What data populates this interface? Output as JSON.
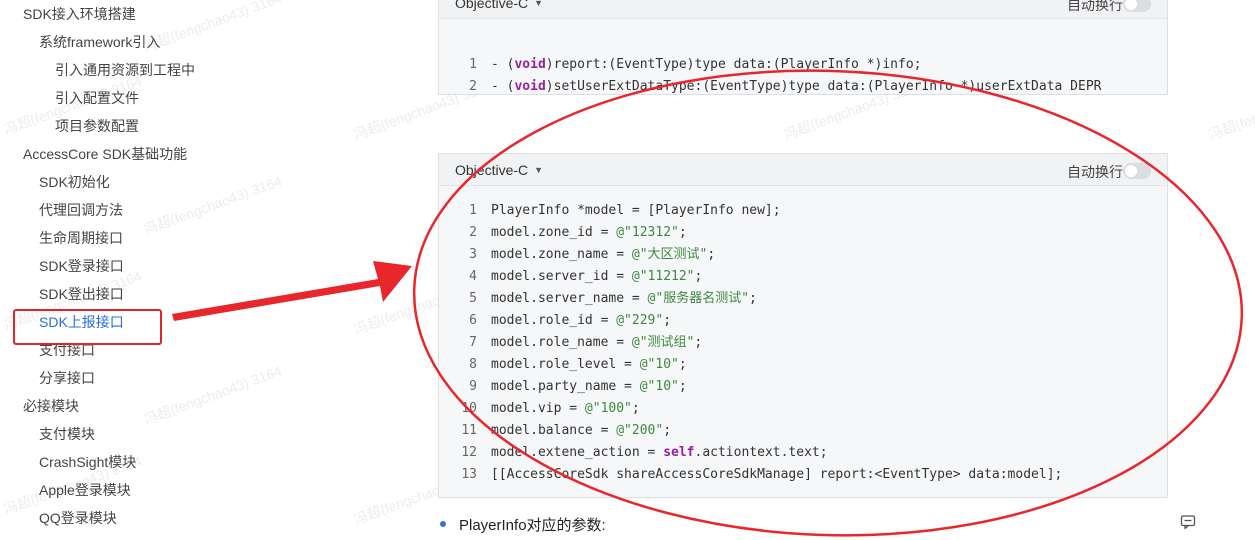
{
  "sidebar": {
    "items": [
      {
        "label": "SDK接入环境搭建"
      },
      {
        "label": "系统framework引入"
      },
      {
        "label": "引入通用资源到工程中"
      },
      {
        "label": "引入配置文件"
      },
      {
        "label": "项目参数配置"
      },
      {
        "label": "AccessCore SDK基础功能"
      },
      {
        "label": "SDK初始化"
      },
      {
        "label": "代理回调方法"
      },
      {
        "label": "生命周期接口"
      },
      {
        "label": "SDK登录接口"
      },
      {
        "label": "SDK登出接口"
      },
      {
        "label": "SDK上报接口"
      },
      {
        "label": "支付接口"
      },
      {
        "label": "分享接口"
      },
      {
        "label": "必接模块"
      },
      {
        "label": "支付模块"
      },
      {
        "label": "CrashSight模块"
      },
      {
        "label": "Apple登录模块"
      },
      {
        "label": "QQ登录模块"
      }
    ]
  },
  "code_blocks": [
    {
      "language": "Objective-C",
      "wrap_label": "自动换行",
      "wrap_enabled": false,
      "lines": [
        {
          "n": "1",
          "code": "- (void)report:(EventType)type data:(PlayerInfo *)info;"
        },
        {
          "n": "2",
          "code": "- (void)setUserExtDataType:(EventType)type data:(PlayerInfo *)userExtData DEPR"
        }
      ]
    },
    {
      "language": "Objective-C",
      "wrap_label": "自动换行",
      "wrap_enabled": false,
      "lines": [
        {
          "n": "1",
          "code": "PlayerInfo *model = [PlayerInfo new];"
        },
        {
          "n": "2",
          "code": "model.zone_id = @\"12312\";"
        },
        {
          "n": "3",
          "code": "model.zone_name = @\"大区测试\";"
        },
        {
          "n": "4",
          "code": "model.server_id = @\"11212\";"
        },
        {
          "n": "5",
          "code": "model.server_name = @\"服务器名测试\";"
        },
        {
          "n": "6",
          "code": "model.role_id = @\"229\";"
        },
        {
          "n": "7",
          "code": "model.role_name = @\"测试组\";"
        },
        {
          "n": "8",
          "code": "model.role_level = @\"10\";"
        },
        {
          "n": "9",
          "code": "model.party_name = @\"10\";"
        },
        {
          "n": "10",
          "code": "model.vip = @\"100\";"
        },
        {
          "n": "11",
          "code": "model.balance = @\"200\";"
        },
        {
          "n": "12",
          "code": "model.extene_action = self.actiontext.text;"
        },
        {
          "n": "13",
          "code": "[[AccessCoreSdk shareAccessCoreSdkManage] report:<EventType> data:model];"
        }
      ]
    }
  ],
  "bullet_text": "PlayerInfo对应的参数:",
  "watermark_text": "冯超(fengchao43) 3164",
  "colors": {
    "accent": "#2a6bdc",
    "annotation": "#e0242a",
    "keyword": "#9a1f9e",
    "string": "#3b8a3b"
  },
  "icons": {
    "comment": "comment-icon",
    "dropdown": "caret-down-icon",
    "toggle": "toggle-switch"
  }
}
